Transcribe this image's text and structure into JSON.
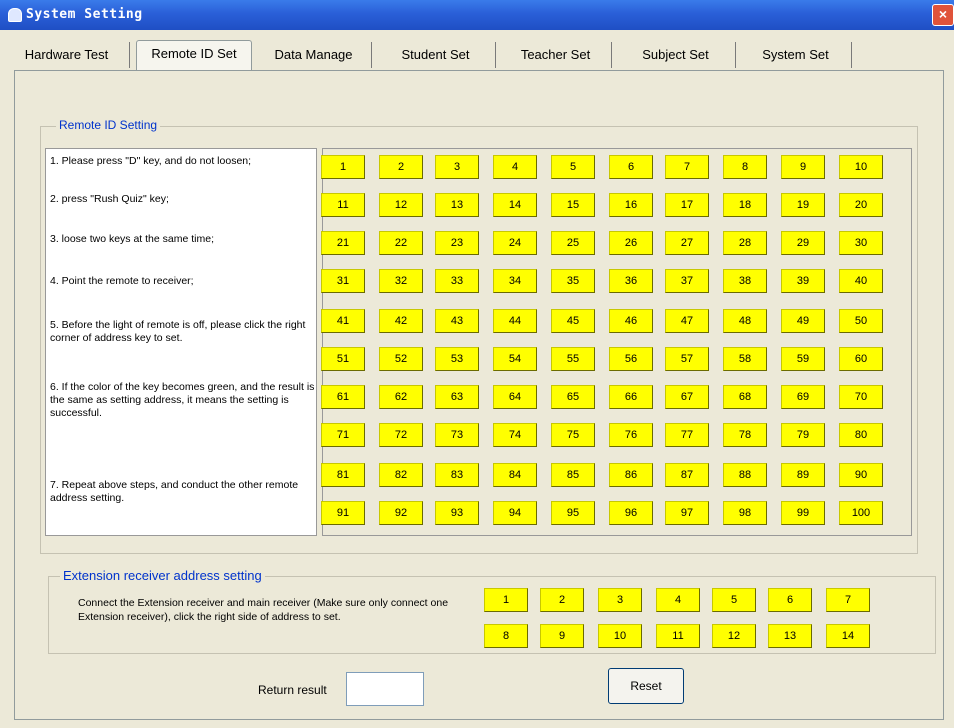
{
  "window": {
    "title": "System Setting",
    "close_glyph": "×"
  },
  "tabs": [
    {
      "label": "Hardware Test",
      "active": false
    },
    {
      "label": "Remote ID Set",
      "active": true
    },
    {
      "label": "Data Manage",
      "active": false
    },
    {
      "label": "Student Set",
      "active": false
    },
    {
      "label": "Teacher Set",
      "active": false
    },
    {
      "label": "Subject Set",
      "active": false
    },
    {
      "label": "System Set",
      "active": false
    }
  ],
  "remote_id": {
    "group_title": "Remote ID Setting",
    "instructions": [
      "1. Please press \"D\" key, and do not loosen;",
      "2. press \"Rush Quiz\" key;",
      "3. loose two keys at the same time;",
      "4. Point the remote to receiver;",
      "5. Before the light of remote is off, please click the right corner of address key to set.",
      "6. If the color of the key becomes green, and the result is the same as setting address, it means the setting is successful.",
      "7. Repeat above steps, and conduct the other remote address setting."
    ],
    "buttons": [
      "1",
      "2",
      "3",
      "4",
      "5",
      "6",
      "7",
      "8",
      "9",
      "10",
      "11",
      "12",
      "13",
      "14",
      "15",
      "16",
      "17",
      "18",
      "19",
      "20",
      "21",
      "22",
      "23",
      "24",
      "25",
      "26",
      "27",
      "28",
      "29",
      "30",
      "31",
      "32",
      "33",
      "34",
      "35",
      "36",
      "37",
      "38",
      "39",
      "40",
      "41",
      "42",
      "43",
      "44",
      "45",
      "46",
      "47",
      "48",
      "49",
      "50",
      "51",
      "52",
      "53",
      "54",
      "55",
      "56",
      "57",
      "58",
      "59",
      "60",
      "61",
      "62",
      "63",
      "64",
      "65",
      "66",
      "67",
      "68",
      "69",
      "70",
      "71",
      "72",
      "73",
      "74",
      "75",
      "76",
      "77",
      "78",
      "79",
      "80",
      "81",
      "82",
      "83",
      "84",
      "85",
      "86",
      "87",
      "88",
      "89",
      "90",
      "91",
      "92",
      "93",
      "94",
      "95",
      "96",
      "97",
      "98",
      "99",
      "100"
    ]
  },
  "extension": {
    "group_title": "Extension receiver address setting",
    "description": "Connect the Extension receiver and main receiver (Make sure only connect one Extension receiver), click the right side of address to set.",
    "buttons": [
      "1",
      "2",
      "3",
      "4",
      "5",
      "6",
      "7",
      "8",
      "9",
      "10",
      "11",
      "12",
      "13",
      "14"
    ]
  },
  "footer": {
    "return_label": "Return result",
    "return_value": "",
    "reset_label": "Reset"
  },
  "colors": {
    "key_yellow": "#ffff00",
    "title_blue": "#2a5fd8",
    "group_title": "#0033cc"
  }
}
